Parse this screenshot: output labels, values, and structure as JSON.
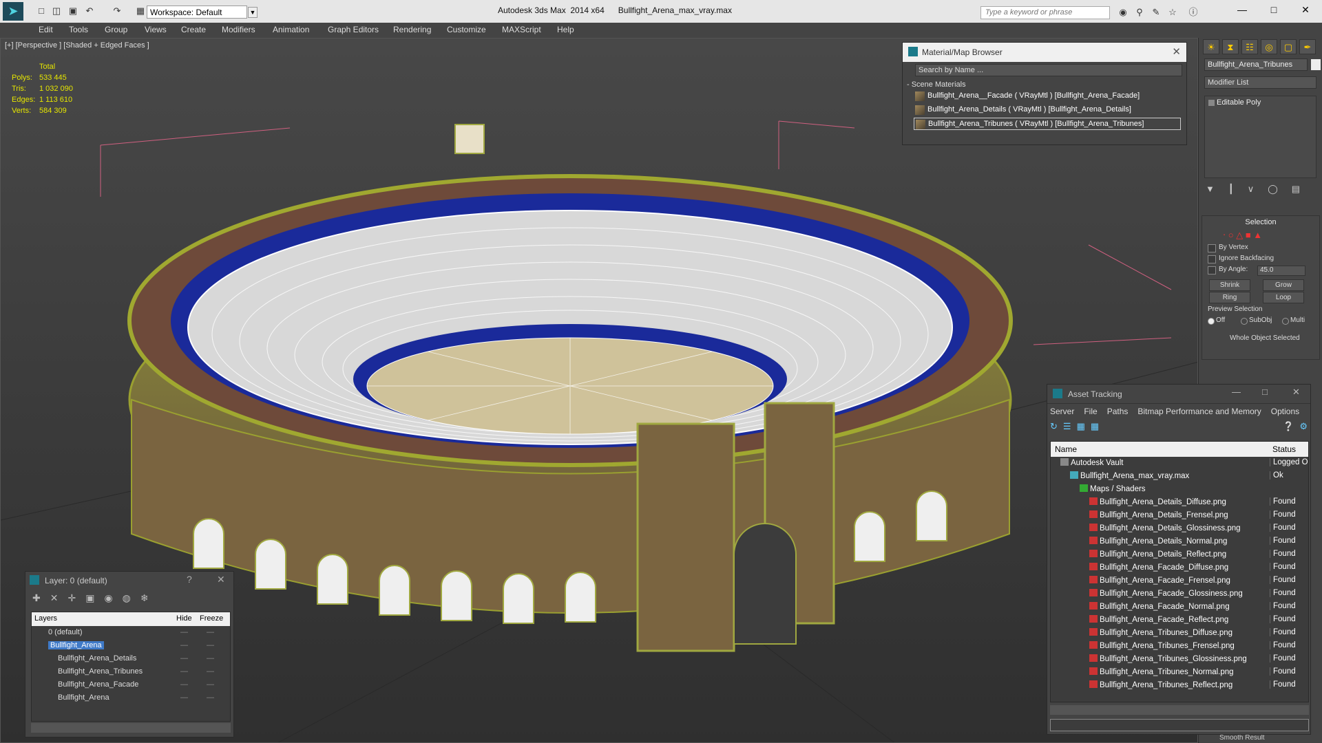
{
  "titlebar": {
    "workspace": "Workspace: Default",
    "app_title": "Autodesk 3ds Max  2014 x64      Bullfight_Arena_max_vray.max",
    "search_placeholder": "Type a keyword or phrase"
  },
  "menu": [
    "Edit",
    "Tools",
    "Group",
    "Views",
    "Create",
    "Modifiers",
    "Animation",
    "Graph Editors",
    "Rendering",
    "Customize",
    "MAXScript",
    "Help"
  ],
  "viewport": {
    "label": "[+] [Perspective ] [Shaded + Edged Faces ]",
    "stats": {
      "header": "Total",
      "rows": [
        {
          "k": "Polys:",
          "v": "533 445"
        },
        {
          "k": "Tris:",
          "v": "1 032 090"
        },
        {
          "k": "Edges:",
          "v": "1 113 610"
        },
        {
          "k": "Verts:",
          "v": "584 309"
        }
      ]
    }
  },
  "material_browser": {
    "title": "Material/Map Browser",
    "search_placeholder": "Search by Name ...",
    "section": "- Scene Materials",
    "materials": [
      "Bullfight_Arena__Facade  ( VRayMtl ) [Bullfight_Arena_Facade]",
      "Bullfight_Arena_Details  ( VRayMtl ) [Bullfight_Arena_Details]",
      "Bullfight_Arena_Tribunes  ( VRayMtl ) [Bullfight_Arena_Tribunes]"
    ]
  },
  "command_panel": {
    "object_name": "Bullfight_Arena_Tribunes",
    "modifier_list": "Modifier List",
    "stack": [
      "Editable Poly"
    ],
    "selection": {
      "title": "Selection",
      "by_vertex": "By Vertex",
      "ignore_backfacing": "Ignore Backfacing",
      "by_angle": "By Angle:",
      "angle_value": "45.0",
      "shrink": "Shrink",
      "grow": "Grow",
      "ring": "Ring",
      "loop": "Loop",
      "preview": "Preview Selection",
      "off": "Off",
      "subobj": "SubObj",
      "multi": "Multi",
      "whole": "Whole Object Selected",
      "smooth": "Smooth Result"
    }
  },
  "asset_tracking": {
    "title": "Asset Tracking",
    "menu": [
      "Server",
      "File",
      "Paths",
      "Bitmap Performance and Memory",
      "Options"
    ],
    "col_name": "Name",
    "col_status": "Status",
    "rows": [
      {
        "name": "Autodesk Vault",
        "status": "Logged Ou",
        "indent": 1,
        "icon": "vault"
      },
      {
        "name": "Bullfight_Arena_max_vray.max",
        "status": "Ok",
        "indent": 2,
        "icon": "max"
      },
      {
        "name": "Maps / Shaders",
        "status": "",
        "indent": 3,
        "icon": "folder"
      },
      {
        "name": "Bullfight_Arena_Details_Diffuse.png",
        "status": "Found",
        "indent": 4,
        "icon": "png"
      },
      {
        "name": "Bullfight_Arena_Details_Frensel.png",
        "status": "Found",
        "indent": 4,
        "icon": "png"
      },
      {
        "name": "Bullfight_Arena_Details_Glossiness.png",
        "status": "Found",
        "indent": 4,
        "icon": "png"
      },
      {
        "name": "Bullfight_Arena_Details_Normal.png",
        "status": "Found",
        "indent": 4,
        "icon": "png"
      },
      {
        "name": "Bullfight_Arena_Details_Reflect.png",
        "status": "Found",
        "indent": 4,
        "icon": "png"
      },
      {
        "name": "Bullfight_Arena_Facade_Diffuse.png",
        "status": "Found",
        "indent": 4,
        "icon": "png"
      },
      {
        "name": "Bullfight_Arena_Facade_Frensel.png",
        "status": "Found",
        "indent": 4,
        "icon": "png"
      },
      {
        "name": "Bullfight_Arena_Facade_Glossiness.png",
        "status": "Found",
        "indent": 4,
        "icon": "png"
      },
      {
        "name": "Bullfight_Arena_Facade_Normal.png",
        "status": "Found",
        "indent": 4,
        "icon": "png"
      },
      {
        "name": "Bullfight_Arena_Facade_Reflect.png",
        "status": "Found",
        "indent": 4,
        "icon": "png"
      },
      {
        "name": "Bullfight_Arena_Tribunes_Diffuse.png",
        "status": "Found",
        "indent": 4,
        "icon": "png"
      },
      {
        "name": "Bullfight_Arena_Tribunes_Frensel.png",
        "status": "Found",
        "indent": 4,
        "icon": "png"
      },
      {
        "name": "Bullfight_Arena_Tribunes_Glossiness.png",
        "status": "Found",
        "indent": 4,
        "icon": "png"
      },
      {
        "name": "Bullfight_Arena_Tribunes_Normal.png",
        "status": "Found",
        "indent": 4,
        "icon": "png"
      },
      {
        "name": "Bullfight_Arena_Tribunes_Reflect.png",
        "status": "Found",
        "indent": 4,
        "icon": "png"
      }
    ]
  },
  "layers": {
    "title": "Layer: 0 (default)",
    "help": "?",
    "col_layers": "Layers",
    "col_hide": "Hide",
    "col_freeze": "Freeze",
    "rows": [
      {
        "name": "0 (default)",
        "indent": 1,
        "selected": false
      },
      {
        "name": "Bullfight_Arena",
        "indent": 1,
        "selected": true
      },
      {
        "name": "Bullfight_Arena_Details",
        "indent": 2,
        "selected": false
      },
      {
        "name": "Bullfight_Arena_Tribunes",
        "indent": 2,
        "selected": false
      },
      {
        "name": "Bullfight_Arena_Facade",
        "indent": 2,
        "selected": false
      },
      {
        "name": "Bullfight_Arena",
        "indent": 2,
        "selected": false
      }
    ]
  }
}
